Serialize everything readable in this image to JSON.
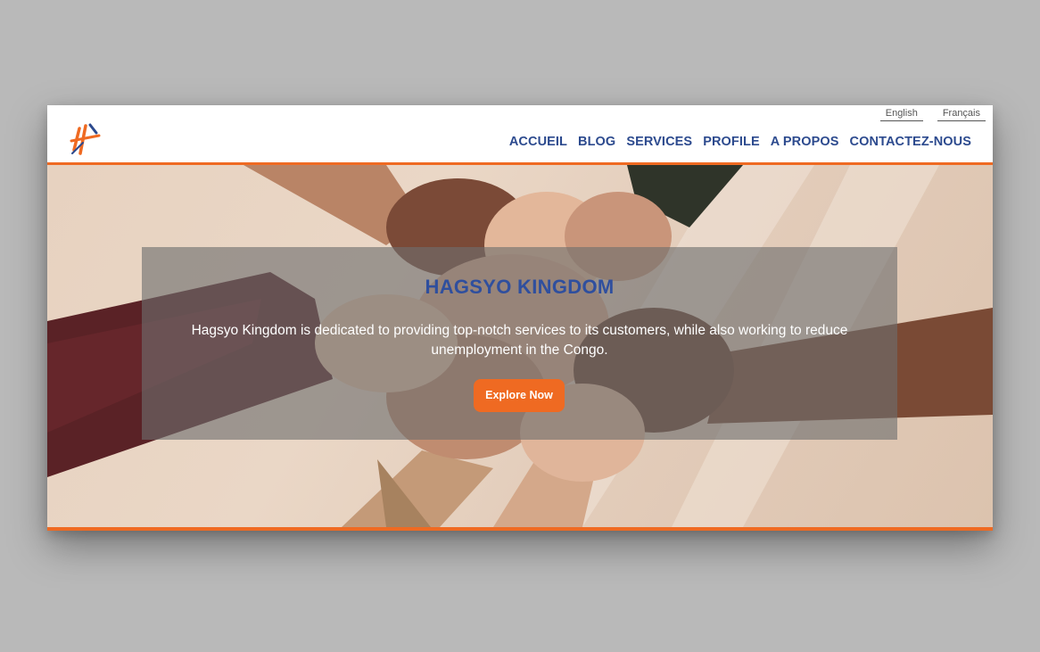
{
  "language_switch": [
    "English",
    "Français"
  ],
  "nav": {
    "items": [
      "ACCUEIL",
      "BLOG",
      "SERVICES",
      "PROFILE",
      "A PROPOS",
      "CONTACTEZ-NOUS"
    ]
  },
  "hero": {
    "title": "HAGSYO KINGDOM",
    "description": "Hagsyo Kingdom is dedicated to providing top-notch services to its customers, while also working to reduce unemployment in the Congo.",
    "button_label": "Explore Now"
  },
  "colors": {
    "accent": "#ef6a22",
    "nav_text": "#2c4a8e",
    "title_text": "#2f4f9e",
    "background": "#b9b9b9"
  },
  "icons": {
    "logo": "hagsyo-logo"
  }
}
